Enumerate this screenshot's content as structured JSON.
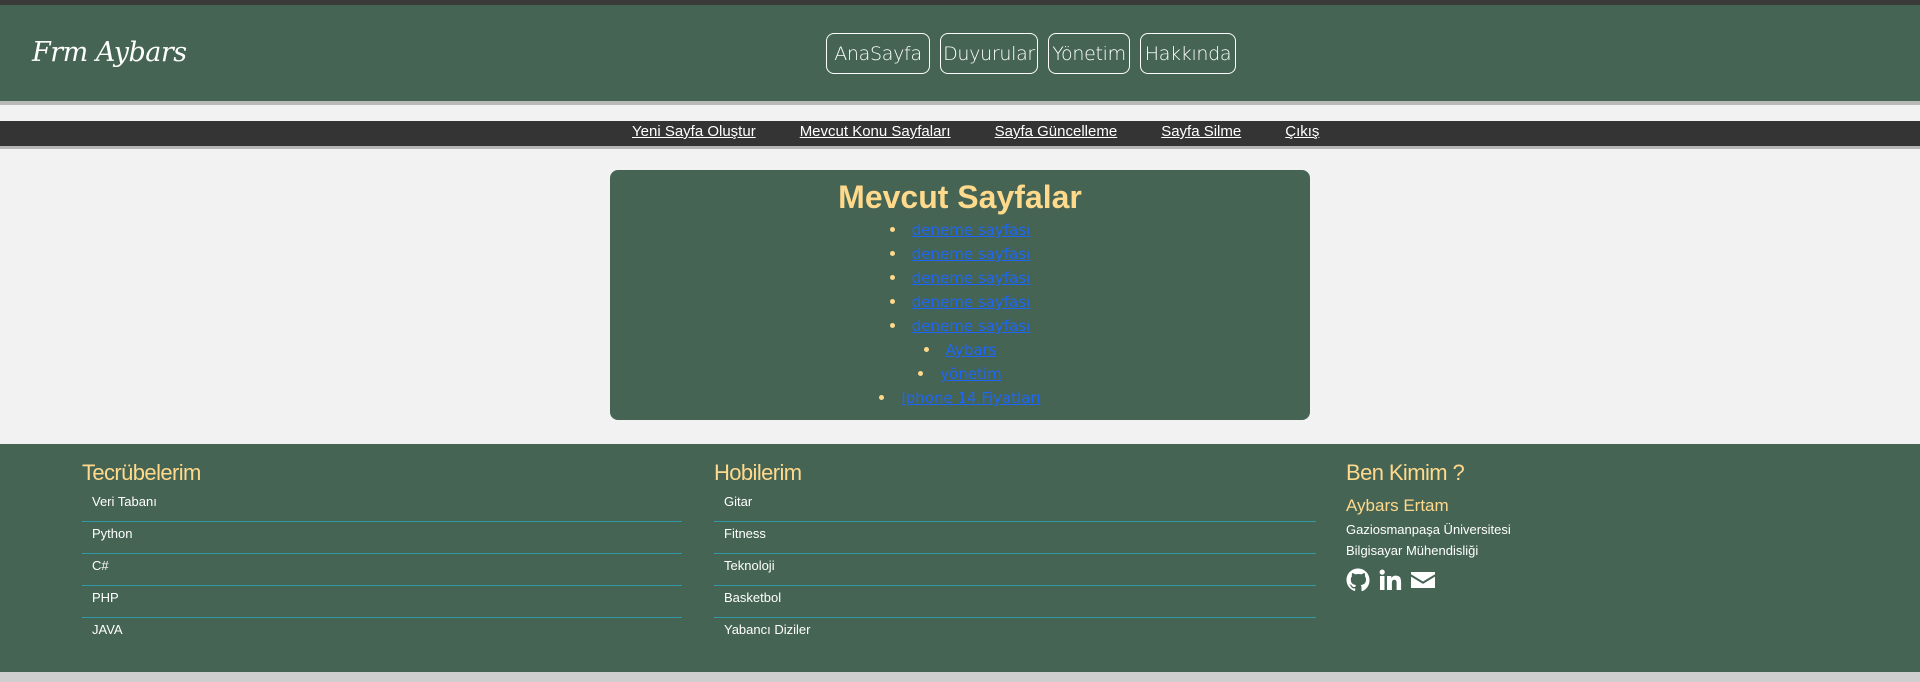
{
  "header": {
    "logo": "Frm Aybars",
    "nav": [
      "AnaSayfa",
      "Duyurular",
      "Yönetim",
      "Hakkında"
    ]
  },
  "subnav": {
    "links": [
      "Yeni Sayfa Oluştur",
      "Mevcut Konu Sayfaları",
      "Sayfa Güncelleme",
      "Sayfa Silme",
      "Çıkış"
    ]
  },
  "panel": {
    "title": "Mevcut Sayfalar",
    "pages": [
      "deneme sayfası",
      "deneme sayfası",
      "deneme sayfası",
      "deneme sayfası",
      "deneme sayfası",
      "Aybars",
      "yönetim",
      "Iphone 14 Fiyatları"
    ]
  },
  "footer": {
    "experience": {
      "title": "Tecrübelerim",
      "items": [
        "Veri Tabanı",
        "Python",
        "C#",
        "PHP",
        "JAVA"
      ]
    },
    "hobbies": {
      "title": "Hobilerim",
      "items": [
        "Gitar",
        "Fitness",
        "Teknoloji",
        "Basketbol",
        "Yabancı Diziler"
      ]
    },
    "about": {
      "title": "Ben Kimim ?",
      "name": "Aybars Ertam",
      "school": "Gaziosmanpaşa Üniversitesi",
      "department": "Bilgisayar Mühendisliği",
      "social_icons": [
        "github-icon",
        "linkedin-icon",
        "envelope-icon"
      ]
    }
  },
  "colors": {
    "header_bg": "#456453",
    "accent_gold": "#ffd98c",
    "link_blue": "#1e66f5",
    "subnav_bg": "#343434",
    "divider_teal": "#2f98a3"
  }
}
